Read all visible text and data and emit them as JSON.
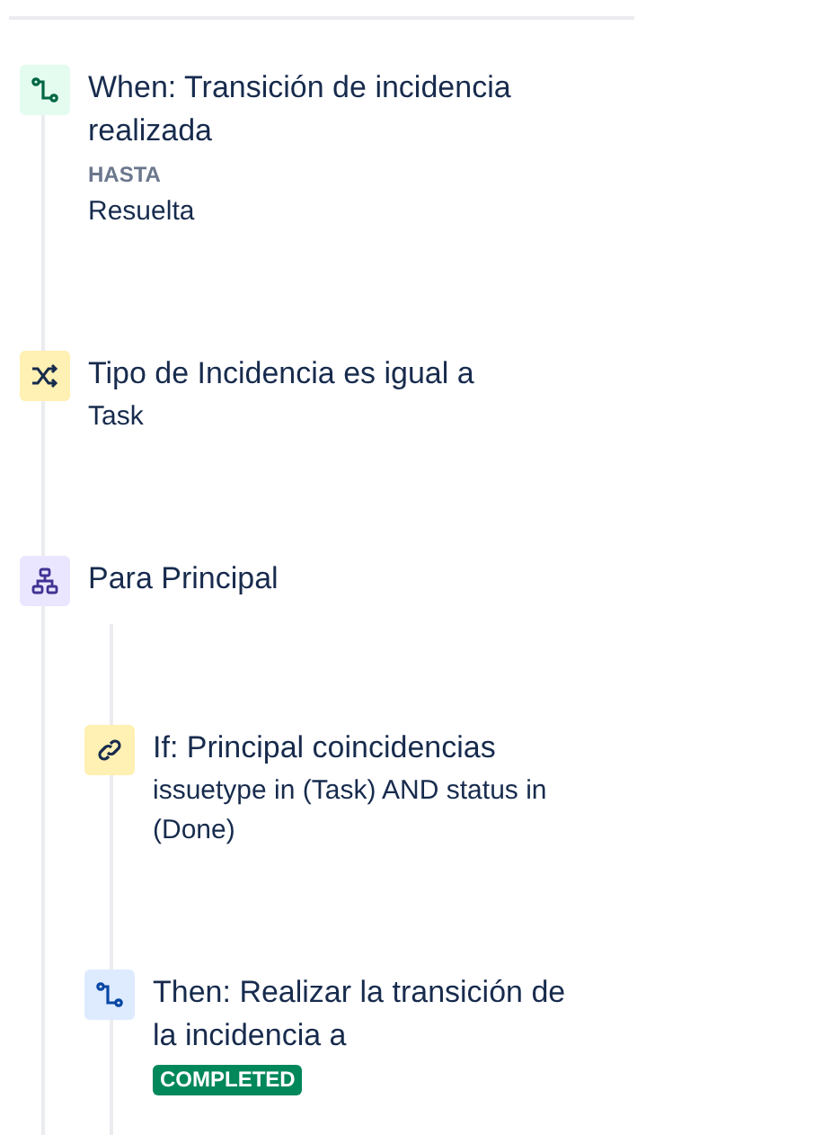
{
  "steps": [
    {
      "kind": "trigger",
      "title": "When: Transición de incidencia realizada",
      "details": [
        {
          "kind": "label",
          "text": "HASTA"
        },
        {
          "kind": "text",
          "text": "Resuelta"
        }
      ]
    },
    {
      "kind": "condition",
      "title": "Tipo de Incidencia es igual a",
      "details": [
        {
          "kind": "text",
          "text": "Task"
        }
      ]
    },
    {
      "kind": "branch",
      "title": "Para Principal",
      "children": [
        {
          "kind": "related",
          "title": "If: Principal coincidencias",
          "details": [
            {
              "kind": "text",
              "text": "issuetype in (Task) AND status in (Done)"
            }
          ]
        },
        {
          "kind": "action",
          "title": "Then: Realizar la transición de la incidencia a",
          "details": [
            {
              "kind": "lozenge",
              "text": "COMPLETED"
            }
          ]
        }
      ]
    }
  ]
}
